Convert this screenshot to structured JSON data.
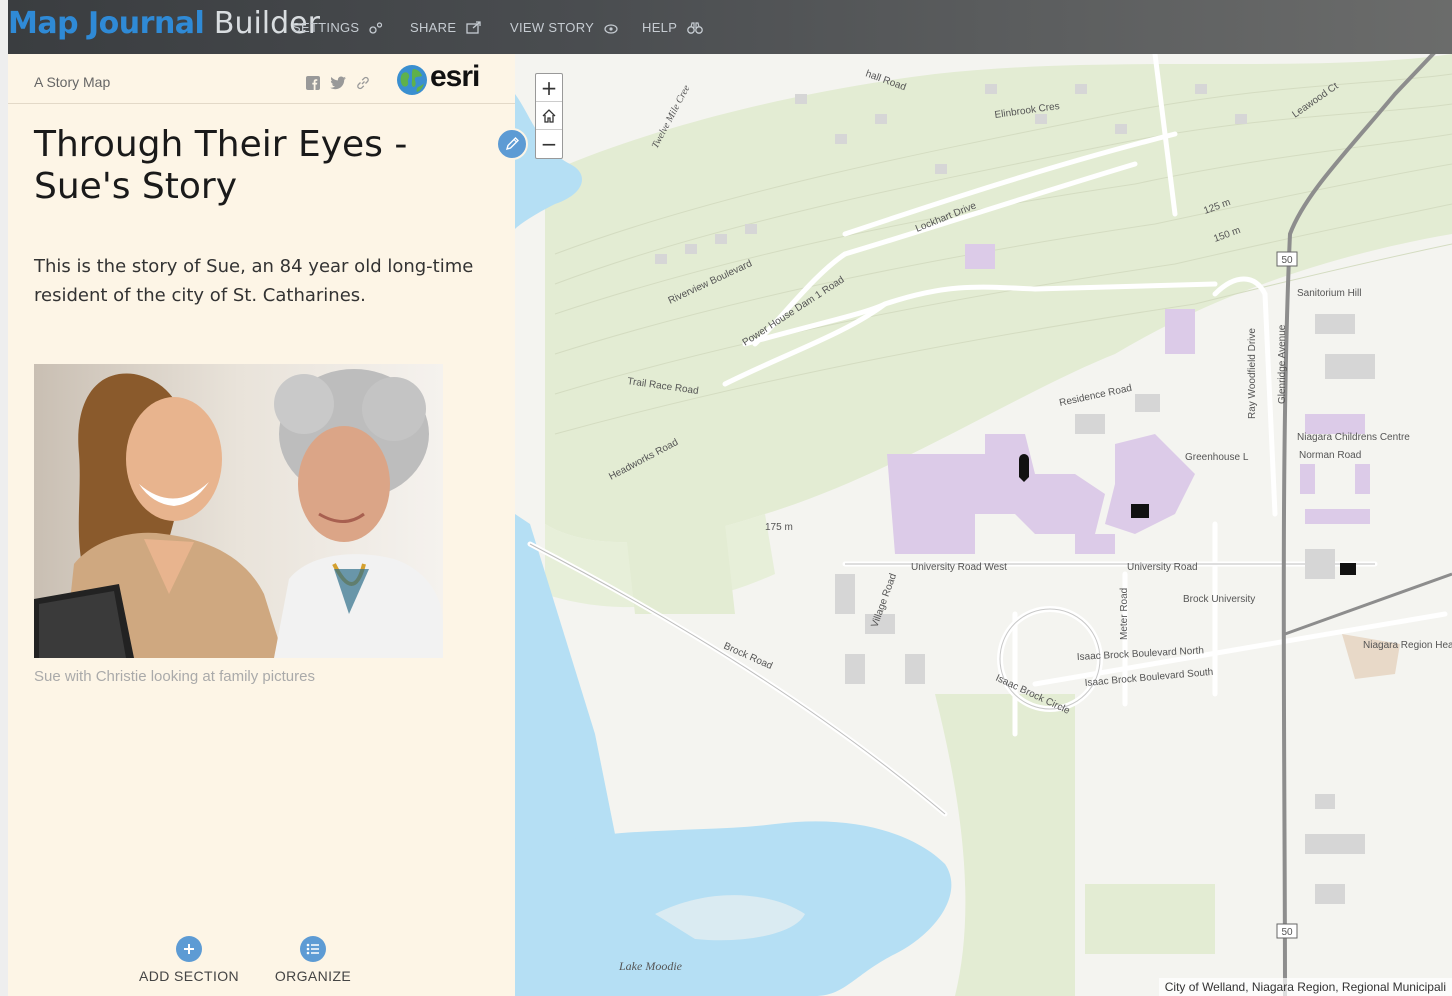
{
  "builder": {
    "brand_primary": "Map Journal",
    "brand_secondary": "Builder",
    "nav": {
      "settings": "SETTINGS",
      "share": "SHARE",
      "view_story": "VIEW STORY",
      "help": "HELP"
    }
  },
  "panel": {
    "tag": "A Story Map",
    "logo_text": "esri",
    "title": "Through Their Eyes - Sue's Story",
    "intro": "This is the story of Sue, an 84 year old long-time resident of the city of St. Catharines.",
    "photo_caption": "Sue with Christie looking at family pictures",
    "add_section": "ADD SECTION",
    "organize": "ORGANIZE"
  },
  "map": {
    "zoom_in": "+",
    "zoom_out": "−",
    "attribution": "City of Welland, Niagara Region, Regional Municipali",
    "labels": {
      "twelve_mile": "Twelve Mile Cree",
      "elinbrook": "Elinbrook Cres",
      "lockhart": "Lockhart Drive",
      "riverview": "Riverview Boulevard",
      "powerhouse": "Power House Dam 1 Road",
      "trail_race": "Trail Race Road",
      "headworks": "Headworks Road",
      "residence": "Residence Road",
      "greenhouse": "Greenhouse L",
      "ray_woodfield": "Ray Woodfield Drive",
      "glenridge": "Glenridge Avenue",
      "sanitorium": "Sanitorium Hill",
      "childrens": "Niagara Childrens Centre",
      "norman": "Norman Road",
      "univ_west": "University Road West",
      "univ_east": "University Road",
      "brock_univ": "Brock University",
      "village": "Village Road",
      "brock_road": "Brock Road",
      "isaac_north": "Isaac Brock Boulevard North",
      "isaac_south": "Isaac Brock Boulevard South",
      "isaac_circle": "Isaac Brock Circle",
      "meter": "Meter Road",
      "region_hq": "Niagara Region Headquarters",
      "lake": "Lake Moodie",
      "contour_175": "175 m",
      "contour_150": "150 m",
      "contour_125": "125 m",
      "route_50": "50",
      "hall": "hall Road",
      "leawood": "Leawood Ct"
    }
  },
  "colors": {
    "brand_blue": "#2f8ad6",
    "panel_bg": "#fdf5e6",
    "accent_button": "#5d9bd4",
    "water": "#b5dff4",
    "park_green": "#e3ecd3",
    "building_purple": "#dccbe8"
  }
}
